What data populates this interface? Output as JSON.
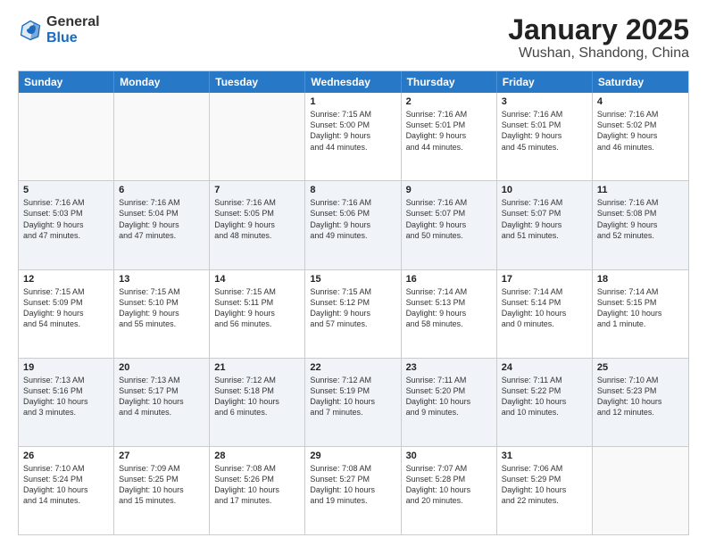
{
  "logo": {
    "general": "General",
    "blue": "Blue"
  },
  "title": "January 2025",
  "subtitle": "Wushan, Shandong, China",
  "headers": [
    "Sunday",
    "Monday",
    "Tuesday",
    "Wednesday",
    "Thursday",
    "Friday",
    "Saturday"
  ],
  "weeks": [
    [
      {
        "day": "",
        "info": ""
      },
      {
        "day": "",
        "info": ""
      },
      {
        "day": "",
        "info": ""
      },
      {
        "day": "1",
        "info": "Sunrise: 7:15 AM\nSunset: 5:00 PM\nDaylight: 9 hours\nand 44 minutes."
      },
      {
        "day": "2",
        "info": "Sunrise: 7:16 AM\nSunset: 5:01 PM\nDaylight: 9 hours\nand 44 minutes."
      },
      {
        "day": "3",
        "info": "Sunrise: 7:16 AM\nSunset: 5:01 PM\nDaylight: 9 hours\nand 45 minutes."
      },
      {
        "day": "4",
        "info": "Sunrise: 7:16 AM\nSunset: 5:02 PM\nDaylight: 9 hours\nand 46 minutes."
      }
    ],
    [
      {
        "day": "5",
        "info": "Sunrise: 7:16 AM\nSunset: 5:03 PM\nDaylight: 9 hours\nand 47 minutes."
      },
      {
        "day": "6",
        "info": "Sunrise: 7:16 AM\nSunset: 5:04 PM\nDaylight: 9 hours\nand 47 minutes."
      },
      {
        "day": "7",
        "info": "Sunrise: 7:16 AM\nSunset: 5:05 PM\nDaylight: 9 hours\nand 48 minutes."
      },
      {
        "day": "8",
        "info": "Sunrise: 7:16 AM\nSunset: 5:06 PM\nDaylight: 9 hours\nand 49 minutes."
      },
      {
        "day": "9",
        "info": "Sunrise: 7:16 AM\nSunset: 5:07 PM\nDaylight: 9 hours\nand 50 minutes."
      },
      {
        "day": "10",
        "info": "Sunrise: 7:16 AM\nSunset: 5:07 PM\nDaylight: 9 hours\nand 51 minutes."
      },
      {
        "day": "11",
        "info": "Sunrise: 7:16 AM\nSunset: 5:08 PM\nDaylight: 9 hours\nand 52 minutes."
      }
    ],
    [
      {
        "day": "12",
        "info": "Sunrise: 7:15 AM\nSunset: 5:09 PM\nDaylight: 9 hours\nand 54 minutes."
      },
      {
        "day": "13",
        "info": "Sunrise: 7:15 AM\nSunset: 5:10 PM\nDaylight: 9 hours\nand 55 minutes."
      },
      {
        "day": "14",
        "info": "Sunrise: 7:15 AM\nSunset: 5:11 PM\nDaylight: 9 hours\nand 56 minutes."
      },
      {
        "day": "15",
        "info": "Sunrise: 7:15 AM\nSunset: 5:12 PM\nDaylight: 9 hours\nand 57 minutes."
      },
      {
        "day": "16",
        "info": "Sunrise: 7:14 AM\nSunset: 5:13 PM\nDaylight: 9 hours\nand 58 minutes."
      },
      {
        "day": "17",
        "info": "Sunrise: 7:14 AM\nSunset: 5:14 PM\nDaylight: 10 hours\nand 0 minutes."
      },
      {
        "day": "18",
        "info": "Sunrise: 7:14 AM\nSunset: 5:15 PM\nDaylight: 10 hours\nand 1 minute."
      }
    ],
    [
      {
        "day": "19",
        "info": "Sunrise: 7:13 AM\nSunset: 5:16 PM\nDaylight: 10 hours\nand 3 minutes."
      },
      {
        "day": "20",
        "info": "Sunrise: 7:13 AM\nSunset: 5:17 PM\nDaylight: 10 hours\nand 4 minutes."
      },
      {
        "day": "21",
        "info": "Sunrise: 7:12 AM\nSunset: 5:18 PM\nDaylight: 10 hours\nand 6 minutes."
      },
      {
        "day": "22",
        "info": "Sunrise: 7:12 AM\nSunset: 5:19 PM\nDaylight: 10 hours\nand 7 minutes."
      },
      {
        "day": "23",
        "info": "Sunrise: 7:11 AM\nSunset: 5:20 PM\nDaylight: 10 hours\nand 9 minutes."
      },
      {
        "day": "24",
        "info": "Sunrise: 7:11 AM\nSunset: 5:22 PM\nDaylight: 10 hours\nand 10 minutes."
      },
      {
        "day": "25",
        "info": "Sunrise: 7:10 AM\nSunset: 5:23 PM\nDaylight: 10 hours\nand 12 minutes."
      }
    ],
    [
      {
        "day": "26",
        "info": "Sunrise: 7:10 AM\nSunset: 5:24 PM\nDaylight: 10 hours\nand 14 minutes."
      },
      {
        "day": "27",
        "info": "Sunrise: 7:09 AM\nSunset: 5:25 PM\nDaylight: 10 hours\nand 15 minutes."
      },
      {
        "day": "28",
        "info": "Sunrise: 7:08 AM\nSunset: 5:26 PM\nDaylight: 10 hours\nand 17 minutes."
      },
      {
        "day": "29",
        "info": "Sunrise: 7:08 AM\nSunset: 5:27 PM\nDaylight: 10 hours\nand 19 minutes."
      },
      {
        "day": "30",
        "info": "Sunrise: 7:07 AM\nSunset: 5:28 PM\nDaylight: 10 hours\nand 20 minutes."
      },
      {
        "day": "31",
        "info": "Sunrise: 7:06 AM\nSunset: 5:29 PM\nDaylight: 10 hours\nand 22 minutes."
      },
      {
        "day": "",
        "info": ""
      }
    ]
  ]
}
